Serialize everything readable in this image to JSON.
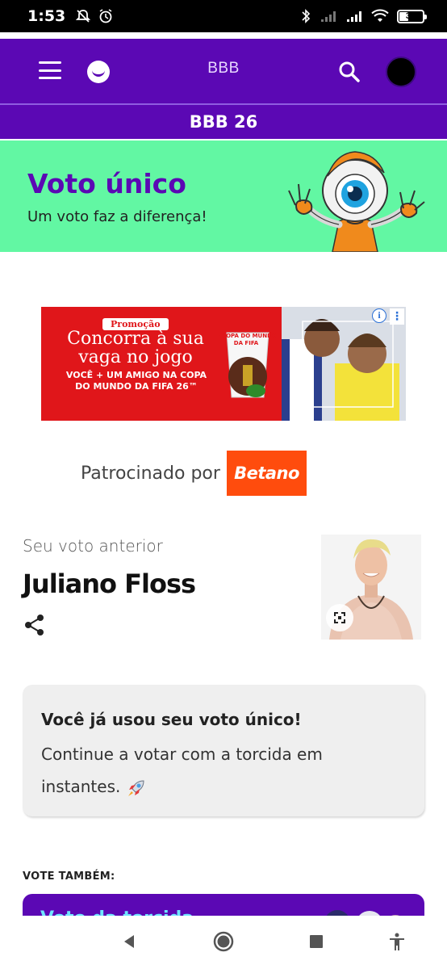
{
  "status_bar": {
    "time": "1:53",
    "battery": "36"
  },
  "header": {
    "brand": "BBB",
    "section_title": "BBB 26"
  },
  "banner": {
    "title": "Voto único",
    "subtitle": "Um voto faz a diferença!"
  },
  "ad": {
    "promo_tag": "Promoção",
    "headline": "Concorra à sua vaga no jogo",
    "subline": "VOCÊ + UM AMIGO NA COPA DO MUNDO DA FIFA 26™",
    "cup_text": "A COPA DO MUNDO DA FIFA",
    "info_icon": "i"
  },
  "sponsor": {
    "label": "Patrocinado por",
    "brand": "Betano"
  },
  "previous_vote": {
    "label": "Seu voto anterior",
    "name": "Juliano Floss"
  },
  "info_card": {
    "title": "Você já usou seu voto único!",
    "body": "Continue a votar com a torcida em instantes."
  },
  "vote_also": {
    "label": "VOTE TAMBÉM:",
    "card_title": "Voto da torcida"
  },
  "colors": {
    "purple": "#5b08b4",
    "green": "#62f7a3",
    "betano": "#ff4c0d",
    "ad_red": "#e0161a"
  },
  "icons": [
    "menu-icon",
    "smile-logo-icon",
    "search-icon",
    "profile-avatar",
    "share-icon",
    "expand-icon",
    "rocket-icon",
    "back-icon",
    "home-icon",
    "recents-icon",
    "accessibility-icon"
  ]
}
